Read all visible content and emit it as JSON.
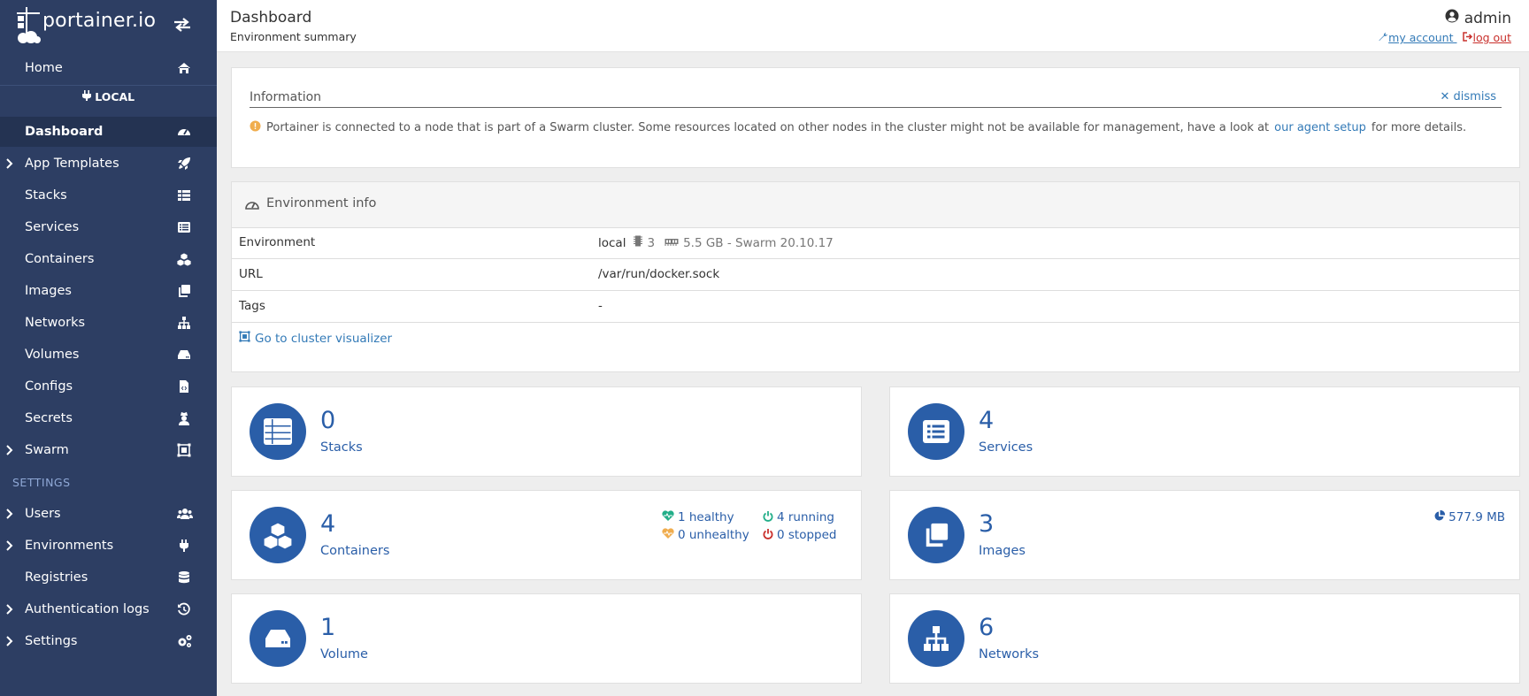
{
  "sidebar": {
    "brand": "portainer.io",
    "env_badge": "LOCAL",
    "settings_heading": "SETTINGS",
    "items": [
      {
        "label": "Home"
      },
      {
        "label": "Dashboard"
      },
      {
        "label": "App Templates"
      },
      {
        "label": "Stacks"
      },
      {
        "label": "Services"
      },
      {
        "label": "Containers"
      },
      {
        "label": "Images"
      },
      {
        "label": "Networks"
      },
      {
        "label": "Volumes"
      },
      {
        "label": "Configs"
      },
      {
        "label": "Secrets"
      },
      {
        "label": "Swarm"
      },
      {
        "label": "Users"
      },
      {
        "label": "Environments"
      },
      {
        "label": "Registries"
      },
      {
        "label": "Authentication logs"
      },
      {
        "label": "Settings"
      }
    ],
    "active_item": "Dashboard"
  },
  "header": {
    "title": "Dashboard",
    "subtitle": "Environment summary",
    "user": "admin",
    "my_account": "my account",
    "log_out": "log out"
  },
  "info": {
    "title": "Information",
    "dismiss": "dismiss",
    "text_before": "Portainer is connected to a node that is part of a Swarm cluster. Some resources located on other nodes in the cluster might not be available for management, have a look at",
    "link": "our agent setup",
    "text_after": "for more details."
  },
  "env_info": {
    "title": "Environment info",
    "rows": [
      {
        "key": "Environment",
        "name": "local",
        "cpu": "3",
        "mem": "5.5 GB - Swarm 20.10.17"
      },
      {
        "key": "URL",
        "value": "/var/run/docker.sock"
      },
      {
        "key": "Tags",
        "value": "-"
      }
    ],
    "cluster_link": "Go to cluster visualizer"
  },
  "cards": {
    "stacks": {
      "count": "0",
      "label": "Stacks"
    },
    "services": {
      "count": "4",
      "label": "Services"
    },
    "containers": {
      "count": "4",
      "label": "Containers",
      "healthy": "1 healthy",
      "unhealthy": "0 unhealthy",
      "running": "4 running",
      "stopped": "0 stopped"
    },
    "images": {
      "count": "3",
      "label": "Images",
      "size": "577.9 MB"
    },
    "volume": {
      "count": "1",
      "label": "Volume"
    },
    "networks": {
      "count": "6",
      "label": "Networks"
    }
  },
  "colors": {
    "sidebar_bg": "#2d3e63",
    "accent": "#2a5ea8",
    "link": "#337ab7",
    "logout": "#c9302c",
    "healthy": "#23ae89",
    "unhealthy": "#f0ad4e",
    "stopped": "#c9302c",
    "warning_icon": "#f0ad4e"
  }
}
